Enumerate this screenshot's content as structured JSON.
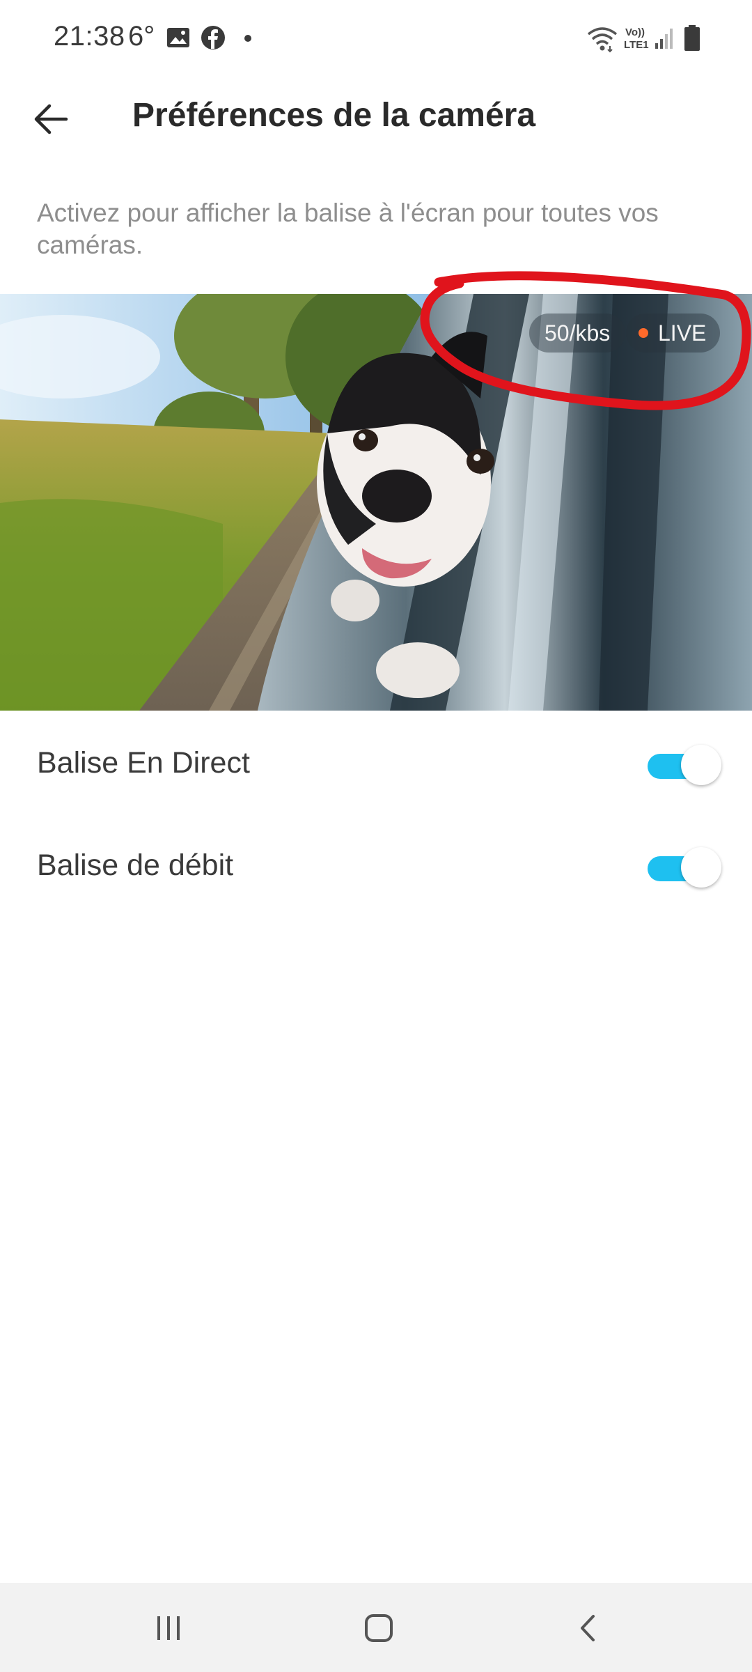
{
  "status_bar": {
    "time": "21:38",
    "temperature": "6°",
    "icons": [
      "gallery-icon",
      "facebook-icon",
      "dot-icon",
      "wifi-icon",
      "volte-icon",
      "signal-icon",
      "battery-icon"
    ],
    "volte_text_top": "Vo))",
    "volte_text_bottom": "LTE1"
  },
  "app_bar": {
    "back_icon": "arrow-left-icon",
    "title": "Préférences de la caméra"
  },
  "description": "Activez pour afficher la balise à l'écran pour toutes vos caméras.",
  "preview": {
    "rate_badge": "50/kbs",
    "live_badge": "LIVE",
    "live_dot_color": "#ff6a2b",
    "annotation_color": "#e0141c"
  },
  "settings": [
    {
      "label": "Balise En Direct",
      "enabled": true
    },
    {
      "label": "Balise de débit",
      "enabled": true
    }
  ],
  "toggle_on_color": "#1ec0f0",
  "nav_bar": {
    "buttons": [
      "recent-apps-icon",
      "home-icon",
      "back-icon"
    ]
  }
}
